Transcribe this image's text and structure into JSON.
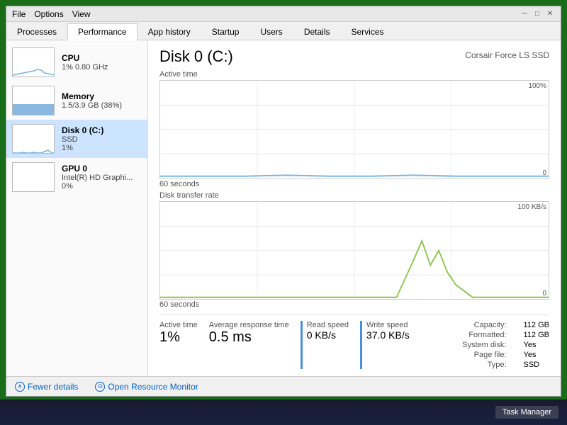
{
  "window": {
    "menu_items": [
      "File",
      "Options",
      "View"
    ],
    "win_btns": [
      "─",
      "□",
      "✕"
    ]
  },
  "tabs": [
    {
      "label": "Processes",
      "active": false
    },
    {
      "label": "Performance",
      "active": true
    },
    {
      "label": "App history",
      "active": false
    },
    {
      "label": "Startup",
      "active": false
    },
    {
      "label": "Users",
      "active": false
    },
    {
      "label": "Details",
      "active": false
    },
    {
      "label": "Services",
      "active": false
    }
  ],
  "sidebar": {
    "items": [
      {
        "id": "cpu",
        "title": "CPU",
        "subtitle": "1% 0.80 GHz",
        "active": false
      },
      {
        "id": "memory",
        "title": "Memory",
        "subtitle": "1.5/3.9 GB (38%)",
        "active": false
      },
      {
        "id": "disk",
        "title": "Disk 0 (C:)",
        "subtitle": "SSD",
        "subtitle2": "1%",
        "active": true
      },
      {
        "id": "gpu",
        "title": "GPU 0",
        "subtitle": "Intel(R) HD Graphi...",
        "subtitle2": "0%",
        "active": false
      }
    ]
  },
  "detail": {
    "title": "Disk 0 (C:)",
    "device": "Corsair Force LS SSD",
    "chart1": {
      "top_label": "Active time",
      "top_value": "100%",
      "bottom_label": "0",
      "time_label": "60 seconds"
    },
    "chart2": {
      "top_label": "Disk transfer rate",
      "top_value": "100 KB/s",
      "bottom_label": "0",
      "time_label": "60 seconds"
    },
    "stats": {
      "active_time_label": "Active time",
      "active_time_value": "1%",
      "avg_response_label": "Average response time",
      "avg_response_value": "0.5 ms",
      "read_speed_label": "Read speed",
      "read_speed_value": "0 KB/s",
      "write_speed_label": "Write speed",
      "write_speed_value": "37.0 KB/s"
    },
    "info": {
      "capacity_label": "Capacity:",
      "capacity_value": "112 GB",
      "formatted_label": "Formatted:",
      "formatted_value": "112 GB",
      "system_disk_label": "System disk:",
      "system_disk_value": "Yes",
      "page_file_label": "Page file:",
      "page_file_value": "Yes",
      "type_label": "Type:",
      "type_value": "SSD"
    }
  },
  "footer": {
    "fewer_details_label": "Fewer details",
    "resource_monitor_label": "Open Resource Monitor"
  },
  "taskbar": {
    "item_label": "Task Manager"
  }
}
